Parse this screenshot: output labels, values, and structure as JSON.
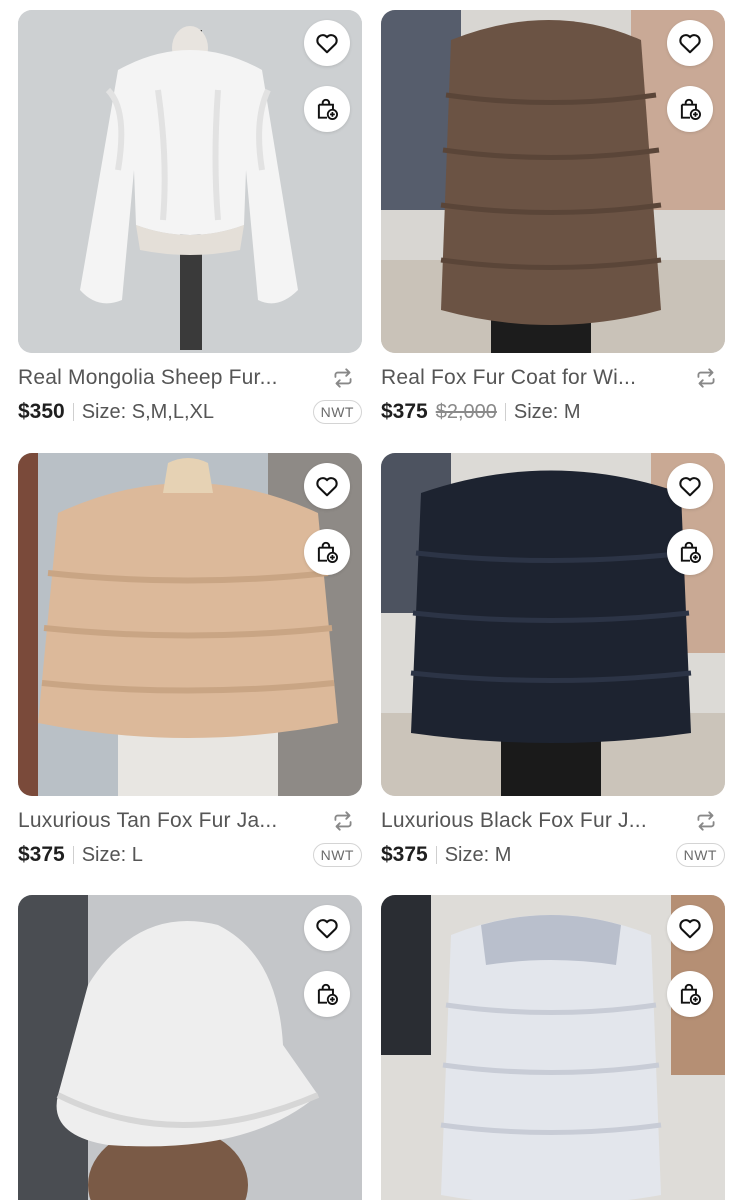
{
  "products": [
    {
      "title": "Real Mongolia Sheep Fur...",
      "price": "$350",
      "original_price": "",
      "size": "Size: S,M,L,XL",
      "badge": "NWT",
      "image": "white-curly-fur-jacket"
    },
    {
      "title": "Real Fox Fur Coat for Wi...",
      "price": "$375",
      "original_price": "$2,000",
      "size": "Size: M",
      "badge": "",
      "image": "brown-fox-fur-coat"
    },
    {
      "title": "Luxurious Tan Fox Fur Ja...",
      "price": "$375",
      "original_price": "",
      "size": "Size: L",
      "badge": "NWT",
      "image": "tan-fox-fur-jacket"
    },
    {
      "title": "Luxurious Black Fox Fur J...",
      "price": "$375",
      "original_price": "",
      "size": "Size: M",
      "badge": "NWT",
      "image": "black-fox-fur-jacket"
    },
    {
      "title": "",
      "price": "",
      "original_price": "",
      "size": "",
      "badge": "",
      "image": "white-fur-bucket-hat"
    },
    {
      "title": "",
      "price": "",
      "original_price": "",
      "size": "",
      "badge": "",
      "image": "silver-fox-fur-jacket"
    }
  ],
  "icons": {
    "like": "heart-icon",
    "bundle": "bag-plus-icon",
    "share": "repost-icon"
  },
  "colors": {
    "text": "#222222",
    "muted": "#555555",
    "badge_border": "#d4d4d4"
  }
}
